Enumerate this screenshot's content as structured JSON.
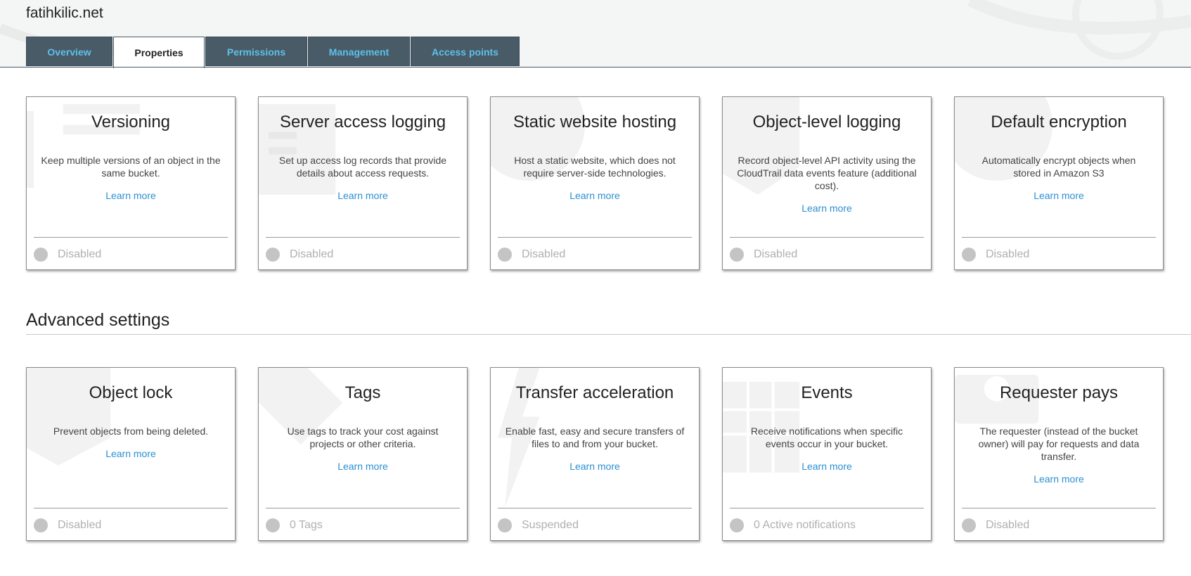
{
  "bucket": {
    "name": "fatihkilic.net"
  },
  "tabs": [
    {
      "label": "Overview",
      "active": false
    },
    {
      "label": "Properties",
      "active": true
    },
    {
      "label": "Permissions",
      "active": false
    },
    {
      "label": "Management",
      "active": false
    },
    {
      "label": "Access points",
      "active": false
    }
  ],
  "properties": [
    {
      "title": "Versioning",
      "description": "Keep multiple versions of an object in the same bucket.",
      "link": "Learn more",
      "status": "Disabled",
      "icon": "versioning-icon"
    },
    {
      "title": "Server access logging",
      "description": "Set up access log records that provide details about access requests.",
      "link": "Learn more",
      "status": "Disabled",
      "icon": "logging-icon"
    },
    {
      "title": "Static website hosting",
      "description": "Host a static website, which does not require server-side technologies.",
      "link": "Learn more",
      "status": "Disabled",
      "icon": "globe-icon"
    },
    {
      "title": "Object-level logging",
      "description": "Record object-level API activity using the CloudTrail data events feature (additional cost).",
      "link": "Learn more",
      "status": "Disabled",
      "icon": "shield-icon"
    },
    {
      "title": "Default encryption",
      "description": "Automatically encrypt objects when stored in Amazon S3",
      "link": "Learn more",
      "status": "Disabled",
      "icon": "encryption-icon"
    }
  ],
  "advanced": {
    "heading": "Advanced settings",
    "items": [
      {
        "title": "Object lock",
        "description": "Prevent objects from being deleted.",
        "link": "Learn more",
        "status": "Disabled",
        "icon": "lock-shield-icon"
      },
      {
        "title": "Tags",
        "description": "Use tags to track your cost against projects or other criteria.",
        "link": "Learn more",
        "status": "0 Tags",
        "icon": "tag-icon"
      },
      {
        "title": "Transfer acceleration",
        "description": "Enable fast, easy and secure transfers of files to and from your bucket.",
        "link": "Learn more",
        "status": "Suspended",
        "icon": "lightning-icon"
      },
      {
        "title": "Events",
        "description": "Receive notifications when specific events occur in your bucket.",
        "link": "Learn more",
        "status": "0 Active notifications",
        "icon": "calendar-icon"
      },
      {
        "title": "Requester pays",
        "description": "The requester (instead of the bucket owner) will pay for requests and data transfer.",
        "link": "Learn more",
        "status": "Disabled",
        "icon": "money-icon"
      }
    ]
  },
  "colors": {
    "tab_bg": "#4a5b68",
    "tab_text": "#5cc0e8",
    "link": "#2b8fd0",
    "status_dot": "#c4c4c4"
  }
}
